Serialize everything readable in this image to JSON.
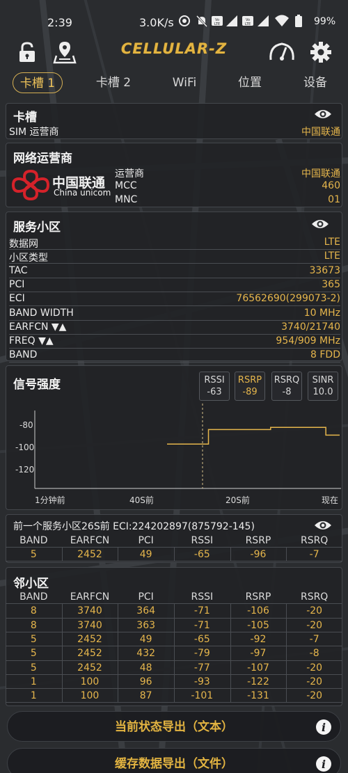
{
  "status_bar": {
    "time": "2:39",
    "net_rate": "3.0K/s",
    "battery_pct": "99%",
    "icons": [
      "hotspot-icon",
      "mute-icon",
      "volte-icon",
      "signal-icon",
      "volte-icon",
      "signal-icon",
      "wifi-icon",
      "battery-icon"
    ]
  },
  "app": {
    "title": "CELLULAR-Z",
    "accent": "#e6b64c"
  },
  "tabs": [
    {
      "label": "卡槽 1",
      "active": true
    },
    {
      "label": "卡槽 2"
    },
    {
      "label": "WiFi"
    },
    {
      "label": "位置"
    },
    {
      "label": "设备"
    }
  ],
  "sim_panel": {
    "title": "卡槽",
    "rows": [
      {
        "key": "SIM 运营商",
        "value": "中国联通"
      }
    ]
  },
  "operator_panel": {
    "title": "网络运营商",
    "logo_cn": "中国联通",
    "logo_en": "China unicom",
    "rows": [
      {
        "key": "运营商",
        "value": "中国联通"
      },
      {
        "key": "MCC",
        "value": "460"
      },
      {
        "key": "MNC",
        "value": "01"
      }
    ]
  },
  "serving_panel": {
    "title": "服务小区",
    "rows": [
      {
        "key": "数据网",
        "value": "LTE"
      },
      {
        "key": "小区类型",
        "value": "LTE"
      },
      {
        "key": "TAC",
        "value": "33673"
      },
      {
        "key": "PCI",
        "value": "365"
      },
      {
        "key": "ECI",
        "value": "76562690(299073-2)"
      },
      {
        "key": "BAND WIDTH",
        "value": "10 MHz"
      },
      {
        "key": "EARFCN ▼▲",
        "value": "3740/21740"
      },
      {
        "key": "FREQ ▼▲",
        "value": "954/909 MHz"
      },
      {
        "key": "BAND",
        "value": "8 FDD"
      }
    ]
  },
  "signal_panel": {
    "title": "信号强度",
    "chips": [
      {
        "name": "RSSI",
        "value": "-63"
      },
      {
        "name": "RSRP",
        "value": "-89",
        "selected": true
      },
      {
        "name": "RSRQ",
        "value": "-8"
      },
      {
        "name": "SINR",
        "value": "10.0"
      }
    ],
    "y_ticks": [
      "-80",
      "-100",
      "-120"
    ],
    "x_ticks": [
      "1分钟前",
      "40S前",
      "20S前",
      "现在"
    ]
  },
  "chart_data": {
    "type": "line",
    "title": "信号强度",
    "series": [
      {
        "name": "RSRP",
        "values": [
          -97,
          -97,
          -97,
          -97,
          -97,
          -97,
          -84,
          -84,
          -84,
          -84,
          -84,
          -84,
          -84,
          -84,
          -84,
          -82,
          -82,
          -82,
          -82,
          -82,
          -82,
          -82,
          -82,
          -89,
          -89,
          -89
        ]
      }
    ],
    "ylim": [
      -130,
      -70
    ],
    "yticks": [
      -80,
      -100,
      -120
    ],
    "xlabel": "",
    "ylabel": "",
    "grid": false
  },
  "prev_cell": {
    "title": "前一个服务小区26S前 ECI:224202897(875792-145)",
    "headers": [
      "BAND",
      "EARFCN",
      "PCI",
      "RSSI",
      "RSRP",
      "RSRQ"
    ],
    "rows": [
      [
        "5",
        "2452",
        "49",
        "-65",
        "-96",
        "-7"
      ]
    ]
  },
  "neighbor_panel": {
    "title": "邻小区",
    "headers": [
      "BAND",
      "EARFCN",
      "PCI",
      "RSSI",
      "RSRP",
      "RSRQ"
    ],
    "rows": [
      [
        "8",
        "3740",
        "364",
        "-71",
        "-106",
        "-20"
      ],
      [
        "8",
        "3740",
        "363",
        "-71",
        "-105",
        "-20"
      ],
      [
        "5",
        "2452",
        "49",
        "-65",
        "-92",
        "-7"
      ],
      [
        "5",
        "2452",
        "432",
        "-79",
        "-97",
        "-8"
      ],
      [
        "5",
        "2452",
        "48",
        "-77",
        "-107",
        "-20"
      ],
      [
        "1",
        "100",
        "96",
        "-93",
        "-122",
        "-20"
      ],
      [
        "1",
        "100",
        "87",
        "-101",
        "-131",
        "-20"
      ]
    ]
  },
  "export": {
    "status_text_label": "当前状态导出（文本）",
    "cache_file_label": "缓存数据导出（文件）"
  }
}
